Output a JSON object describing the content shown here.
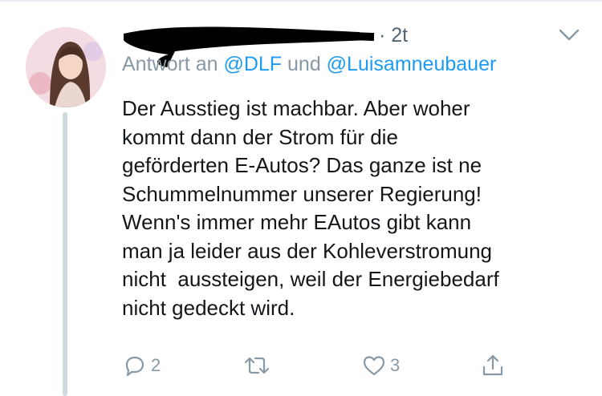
{
  "tweet": {
    "time": "· 2t",
    "reply_prefix": "Antwort an ",
    "mention_1": "@DLF",
    "reply_join": " und ",
    "mention_2": "@Luisamneubauer",
    "text": "Der Ausstieg ist machbar. Aber woher\nkommt dann der Strom für die\ngeförderten E-Autos? Das ganze ist ne\nSchummelnummer unserer Regierung!\nWenn's immer mehr EAutos gibt kann\nman ja leider aus der Kohleverstromung\nnicht  aussteigen, weil der Energiebedarf\nnicht gedeckt wird."
  },
  "actions": {
    "reply_count": "2",
    "like_count": "3"
  },
  "icons": {
    "reply": "reply-icon",
    "retweet": "retweet-icon",
    "like": "heart-icon",
    "share": "share-icon",
    "menu": "chevron-down-icon"
  },
  "colors": {
    "text": "#14171a",
    "secondary": "#8899a6",
    "mention": "#1d9bf0",
    "thread_line": "#cfd9de"
  }
}
